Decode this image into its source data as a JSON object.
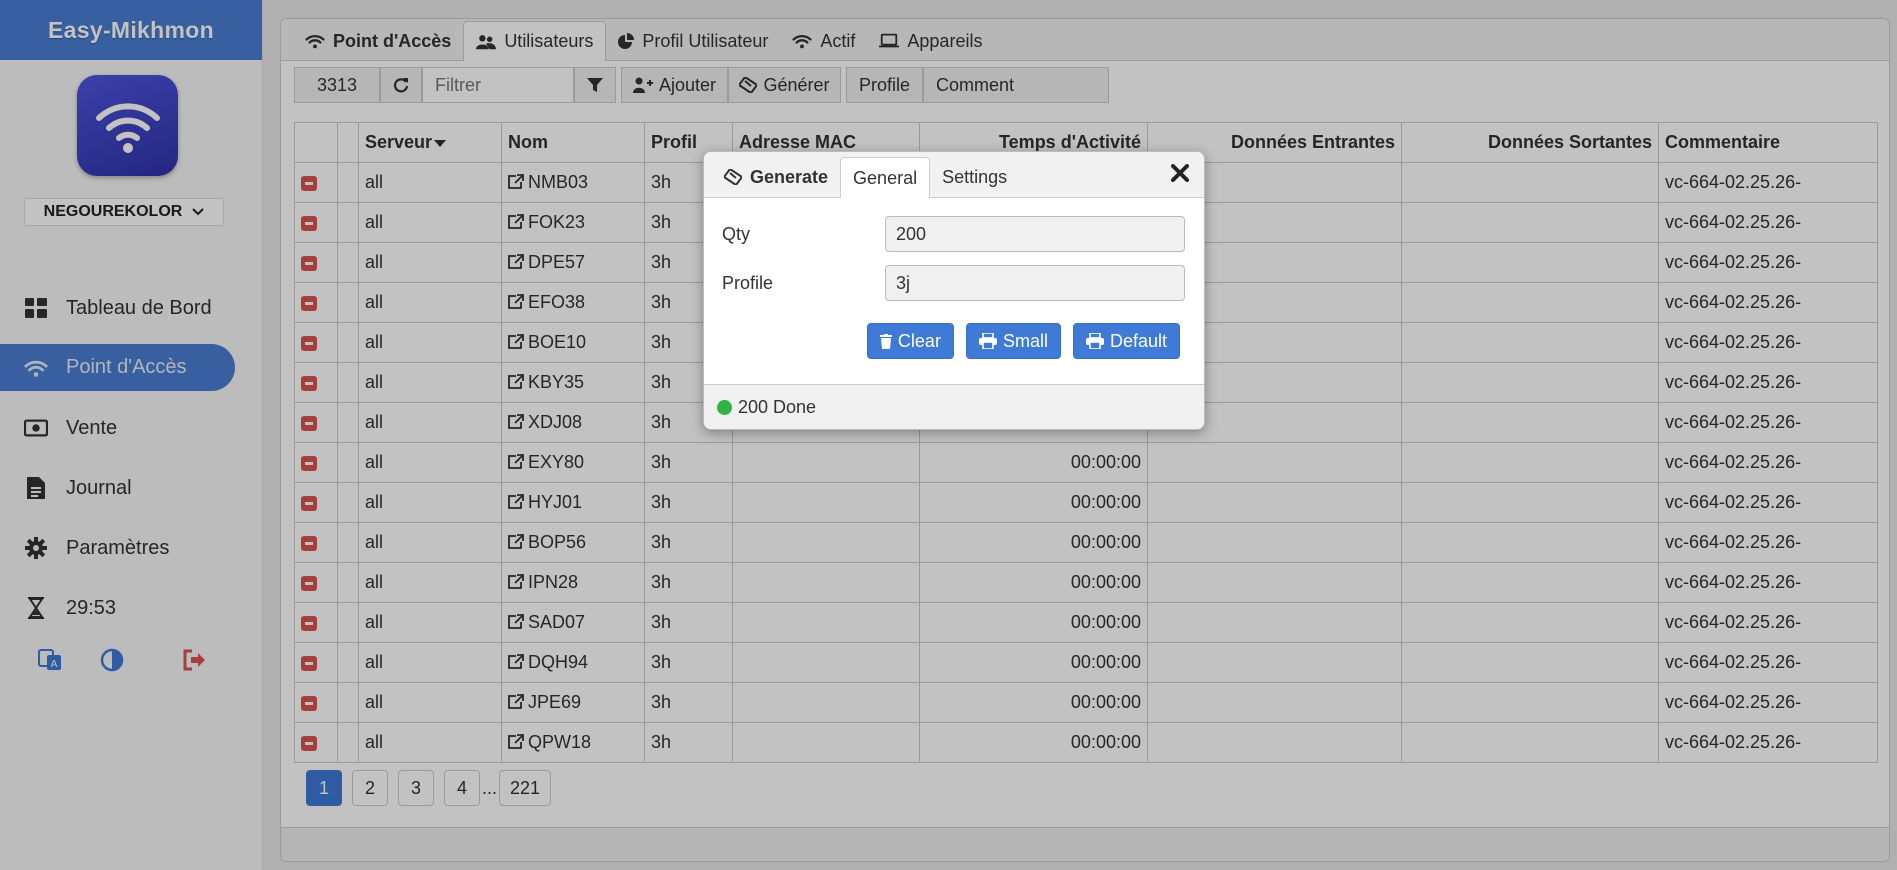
{
  "app": {
    "brand": "Easy-Mikhmon",
    "router": "NEGOUREKOLOR"
  },
  "sidebar": {
    "items": [
      {
        "label": "Tableau de Bord",
        "icon": "dashboard-icon"
      },
      {
        "label": "Point d'Accès",
        "icon": "wifi-icon",
        "active": true
      },
      {
        "label": "Vente",
        "icon": "money-icon"
      },
      {
        "label": "Journal",
        "icon": "file-icon"
      },
      {
        "label": "Paramètres",
        "icon": "gear-icon"
      },
      {
        "label": "29:53",
        "icon": "hourglass-icon"
      }
    ]
  },
  "tabs": {
    "title": "Point d'Accès",
    "items": [
      "Utilisateurs",
      "Profil Utilisateur",
      "Actif",
      "Appareils"
    ],
    "active": "Utilisateurs"
  },
  "toolbar": {
    "count": "3313",
    "filter_placeholder": "Filtrer",
    "add": "Ajouter",
    "generate": "Générer",
    "profile": "Profile",
    "comment": "Comment"
  },
  "table": {
    "headers": [
      "Serveur",
      "Nom",
      "Profil",
      "Adresse MAC",
      "Temps d'Activité",
      "Données Entrantes",
      "Données Sortantes",
      "Commentaire"
    ],
    "rows": [
      {
        "server": "all",
        "name": "NMB03",
        "profile": "3h",
        "mac": "",
        "uptime": "",
        "in": "",
        "out": "",
        "comment": "vc-664-02.25.26-"
      },
      {
        "server": "all",
        "name": "FOK23",
        "profile": "3h",
        "mac": "",
        "uptime": "",
        "in": "",
        "out": "",
        "comment": "vc-664-02.25.26-"
      },
      {
        "server": "all",
        "name": "DPE57",
        "profile": "3h",
        "mac": "",
        "uptime": "",
        "in": "",
        "out": "",
        "comment": "vc-664-02.25.26-"
      },
      {
        "server": "all",
        "name": "EFO38",
        "profile": "3h",
        "mac": "",
        "uptime": "",
        "in": "",
        "out": "",
        "comment": "vc-664-02.25.26-"
      },
      {
        "server": "all",
        "name": "BOE10",
        "profile": "3h",
        "mac": "",
        "uptime": "",
        "in": "",
        "out": "",
        "comment": "vc-664-02.25.26-"
      },
      {
        "server": "all",
        "name": "KBY35",
        "profile": "3h",
        "mac": "",
        "uptime": "",
        "in": "",
        "out": "",
        "comment": "vc-664-02.25.26-"
      },
      {
        "server": "all",
        "name": "XDJ08",
        "profile": "3h",
        "mac": "",
        "uptime": "",
        "in": "",
        "out": "",
        "comment": "vc-664-02.25.26-"
      },
      {
        "server": "all",
        "name": "EXY80",
        "profile": "3h",
        "mac": "",
        "uptime": "00:00:00",
        "in": "",
        "out": "",
        "comment": "vc-664-02.25.26-"
      },
      {
        "server": "all",
        "name": "HYJ01",
        "profile": "3h",
        "mac": "",
        "uptime": "00:00:00",
        "in": "",
        "out": "",
        "comment": "vc-664-02.25.26-"
      },
      {
        "server": "all",
        "name": "BOP56",
        "profile": "3h",
        "mac": "",
        "uptime": "00:00:00",
        "in": "",
        "out": "",
        "comment": "vc-664-02.25.26-"
      },
      {
        "server": "all",
        "name": "IPN28",
        "profile": "3h",
        "mac": "",
        "uptime": "00:00:00",
        "in": "",
        "out": "",
        "comment": "vc-664-02.25.26-"
      },
      {
        "server": "all",
        "name": "SAD07",
        "profile": "3h",
        "mac": "",
        "uptime": "00:00:00",
        "in": "",
        "out": "",
        "comment": "vc-664-02.25.26-"
      },
      {
        "server": "all",
        "name": "DQH94",
        "profile": "3h",
        "mac": "",
        "uptime": "00:00:00",
        "in": "",
        "out": "",
        "comment": "vc-664-02.25.26-"
      },
      {
        "server": "all",
        "name": "JPE69",
        "profile": "3h",
        "mac": "",
        "uptime": "00:00:00",
        "in": "",
        "out": "",
        "comment": "vc-664-02.25.26-"
      },
      {
        "server": "all",
        "name": "QPW18",
        "profile": "3h",
        "mac": "",
        "uptime": "00:00:00",
        "in": "",
        "out": "",
        "comment": "vc-664-02.25.26-"
      }
    ]
  },
  "pagination": {
    "pages": [
      "1",
      "2",
      "3",
      "4"
    ],
    "ellipsis": "...",
    "last": "221",
    "current": "1"
  },
  "modal": {
    "tabs": {
      "title": "Generate",
      "general": "General",
      "settings": "Settings"
    },
    "qty_label": "Qty",
    "qty_value": "200",
    "profile_label": "Profile",
    "profile_value": "3j",
    "buttons": {
      "clear": "Clear",
      "small": "Small",
      "default": "Default"
    },
    "status": "200 Done"
  },
  "colors": {
    "accent": "#4a7fd4",
    "danger": "#d9534f",
    "success": "#2fb344",
    "logo": "#3a3fc2"
  }
}
